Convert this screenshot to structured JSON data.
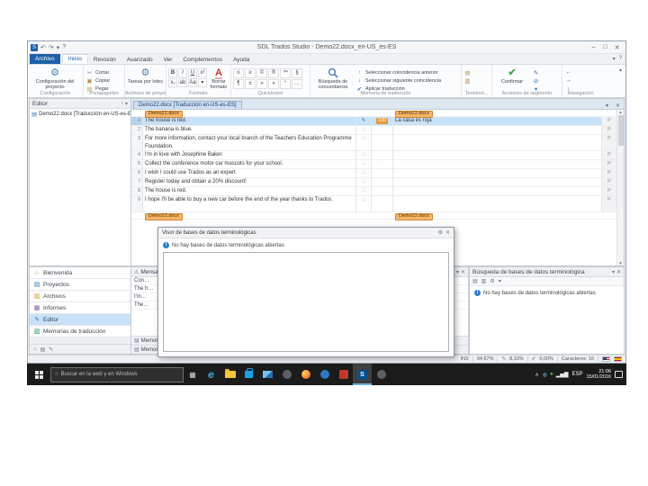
{
  "icons": {
    "app_logo": "S",
    "undo": "↶",
    "redo": "↷",
    "dropdown": "▾",
    "help": "?",
    "minimize": "–",
    "maximize": "□",
    "close": "✕",
    "gear": "⚙",
    "cut": "✂",
    "copy": "▣",
    "paste": "▤",
    "clear_format": "A",
    "confirm": "✔",
    "collapse": "▴",
    "panel_collapse": "‹",
    "panel_pin": "▾",
    "panel_close": "✕",
    "info": "i",
    "warning": "⚠",
    "pencil": "✎",
    "tree_doc": "▤",
    "doc_close": "✕",
    "scroll_up": "▲",
    "scroll_down": "▼",
    "tray_expand": "∧",
    "cortana": "○",
    "taskview": "▦"
  },
  "titlebar": {
    "title": "SDL Trados Studio - Demo22.docx_en-US_es-ES"
  },
  "ribbon": {
    "tabs": [
      {
        "label": "Archivo",
        "cls": "file"
      },
      {
        "label": "Inicio",
        "cls": "active"
      },
      {
        "label": "Revisión"
      },
      {
        "label": "Avanzado"
      },
      {
        "label": "Ver"
      },
      {
        "label": "Complementos"
      },
      {
        "label": "Ayuda"
      }
    ],
    "project_settings_label": "Configuración del proyecto",
    "group_config": "Configuración",
    "cut": "Cortar",
    "copy": "Copiar",
    "paste": "Pegar",
    "group_clipboard": "Portapapeles",
    "batch_tasks_label": "Tareas por lotes",
    "group_project_files": "Archivos de proyecto",
    "format_buttons": [
      {
        "glyph": "B",
        "cls": "fb-b"
      },
      {
        "glyph": "I",
        "cls": "fb-i"
      },
      {
        "glyph": "U",
        "cls": "fb-u"
      },
      {
        "glyph": "x²"
      },
      {
        "glyph": "x₂"
      },
      {
        "glyph": "ab"
      },
      {
        "glyph": "Aa"
      },
      {
        "glyph": "▾"
      }
    ],
    "clear_format_label": "Borrar formato",
    "group_format": "Formato",
    "quickinsert_symbols": [
      {
        "glyph": "≤"
      },
      {
        "glyph": "≥"
      },
      {
        "glyph": "©"
      },
      {
        "glyph": "®"
      },
      {
        "glyph": "™"
      },
      {
        "glyph": "§"
      },
      {
        "glyph": "¶"
      },
      {
        "glyph": "±"
      },
      {
        "glyph": "«"
      },
      {
        "glyph": "»"
      },
      {
        "glyph": "°"
      },
      {
        "glyph": "…"
      }
    ],
    "group_quickinsert": "QuickInsert",
    "concordance_label": "Búsqueda de concordancia",
    "tm_commands": [
      {
        "glyph": "↑",
        "label": "Seleccionar coincidencia anterior"
      },
      {
        "glyph": "↓",
        "label": "Seleccionar siguiente coincidencia"
      },
      {
        "glyph": "✔",
        "label": "Aplicar traducción"
      }
    ],
    "group_tm": "Memoria de traducción",
    "terminology_buttons": [
      {
        "glyph": "▤"
      },
      {
        "glyph": "▥"
      }
    ],
    "group_terminology": "Terminol...",
    "confirm_label": "Confirmar",
    "segment_buttons": [
      {
        "glyph": "✎"
      },
      {
        "glyph": "⊘"
      },
      {
        "glyph": "▾"
      }
    ],
    "group_segment_actions": "Acciones de segmento",
    "nav_buttons": [
      {
        "glyph": "←"
      },
      {
        "glyph": "→"
      },
      {
        "glyph": "↓"
      }
    ],
    "group_navigation": "Navegación"
  },
  "editor_panel": {
    "title": "Editor",
    "tree_item": "Demo22.docx [Traducción en-US-es-ES]"
  },
  "document_tab": {
    "label": "Demo22.docx [Traducción en-US-es-ES]"
  },
  "segments": {
    "doc_tag_top": "Demo22.docx",
    "doc_tag_bottom": "Demo22.docx",
    "rows": [
      {
        "num": "1",
        "source": "The house is red.",
        "status_glyph": "✎",
        "match": "100",
        "target": "La casa es roja",
        "struct": "P",
        "cls": "selected"
      },
      {
        "num": "2",
        "source": "The banana is blue.",
        "status_glyph": "□",
        "match": "",
        "target": "",
        "struct": "P"
      },
      {
        "num": "3",
        "source": "For more information, contact your local branch of the Teachers Education Programme Foundation.",
        "status_glyph": "□",
        "match": "",
        "target": "",
        "struct": "P",
        "cls": "tall"
      },
      {
        "num": "4",
        "source": "I'm in love with Josephine Baker.",
        "status_glyph": "□",
        "match": "",
        "target": "",
        "struct": "P"
      },
      {
        "num": "5",
        "source": "Collect the conference motor car mascots for your school.",
        "status_glyph": "□",
        "match": "",
        "target": "",
        "struct": "P"
      },
      {
        "num": "6",
        "source": "I wish I could use Trados as an expert",
        "status_glyph": "□",
        "match": "",
        "target": "",
        "struct": "P"
      },
      {
        "num": "7",
        "source": "Register today and obtain a 20% discount!",
        "status_glyph": "□",
        "match": "",
        "target": "",
        "struct": "P"
      },
      {
        "num": "8",
        "source": "The house is red.",
        "status_glyph": "□",
        "match": "",
        "target": "",
        "struct": "P"
      },
      {
        "num": "9",
        "source": "I hope I'll be able to buy a new car before the end of the year thanks to Trados.",
        "status_glyph": "□",
        "match": "",
        "target": "",
        "struct": "P",
        "cls": "tall"
      }
    ]
  },
  "nav": {
    "items": [
      {
        "label": "Bienvenida",
        "glyph": "⌂",
        "cls": "c-home"
      },
      {
        "label": "Proyectos",
        "glyph": "▤",
        "cls": "c-proj"
      },
      {
        "label": "Archivos",
        "glyph": "▥",
        "cls": "c-files"
      },
      {
        "label": "Informes",
        "glyph": "▦",
        "cls": "c-rep"
      },
      {
        "label": "Editor",
        "glyph": "✎",
        "cls": "active c-edit"
      },
      {
        "label": "Memorias de traducción",
        "glyph": "▧",
        "cls": "c-tm"
      }
    ],
    "footer_icons": [
      {
        "glyph": "⌂"
      },
      {
        "glyph": "▤"
      },
      {
        "glyph": "✎"
      }
    ]
  },
  "messages_panel": {
    "title": "Mensajes",
    "rows": [
      {
        "text": "Con…"
      },
      {
        "text": "The h…"
      },
      {
        "text": "I'm…"
      },
      {
        "text": "The…"
      }
    ],
    "bars": [
      {
        "text": "MemoriaD…"
      },
      {
        "text": "Memoria…"
      }
    ]
  },
  "termbase_search": {
    "title": "Búsqueda de bases de datos terminológica",
    "toolbar": [
      {
        "glyph": "▤"
      },
      {
        "glyph": "▥"
      },
      {
        "glyph": "⚙"
      },
      {
        "glyph": "▾"
      }
    ],
    "empty_message": "No hay bases de datos terminológicas abiertas"
  },
  "dialog": {
    "title": "Visor de bases de datos terminológicas",
    "empty_message": "No hay bases de datos terminológicas abiertas"
  },
  "statusbar": {
    "ins": "INS",
    "pct1": "94,67%",
    "pct2": "8,33%",
    "pct3": "0,00%",
    "chars": "Caracteres: 16"
  },
  "taskbar": {
    "search_placeholder": "Buscar en la web y en Windows",
    "apps": [
      {
        "cls": "edge",
        "glyph": "e"
      },
      {
        "cls": "folder",
        "glyph": ""
      },
      {
        "cls": "store",
        "glyph": ""
      },
      {
        "cls": "photos",
        "glyph": ""
      },
      {
        "cls": "cdark",
        "glyph": ""
      },
      {
        "cls": "firefox",
        "glyph": ""
      },
      {
        "cls": "cblue",
        "glyph": ""
      },
      {
        "cls": "red",
        "glyph": ""
      },
      {
        "cls": "trados active",
        "glyph": "S"
      },
      {
        "cls": "cdark2",
        "glyph": ""
      }
    ],
    "tray_icons": [
      {
        "glyph": "◍",
        "cls": "t1"
      },
      {
        "glyph": "●",
        "cls": "t2"
      },
      {
        "glyph": "▂▅▇",
        "cls": "t3"
      }
    ],
    "tray_lang": "ESP",
    "time": "21:06",
    "date": "15/01/2016"
  }
}
